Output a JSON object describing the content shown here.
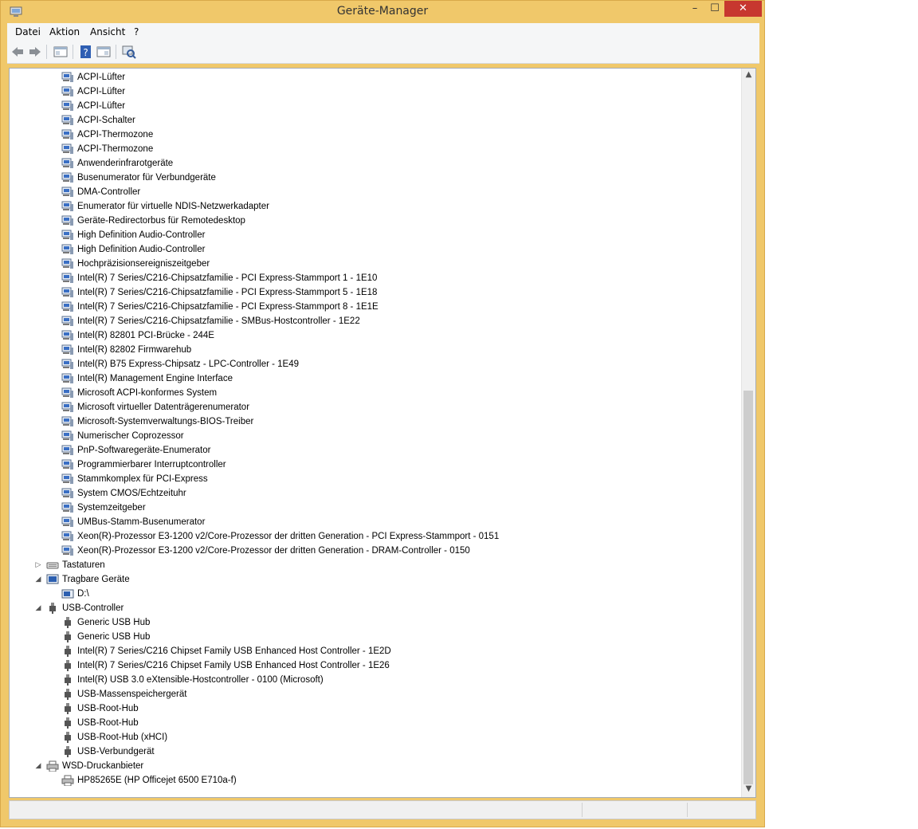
{
  "window": {
    "title": "Geräte-Manager",
    "close_label": "✕",
    "min_label": "–",
    "max_label": "☐"
  },
  "menu": {
    "items": [
      "Datei",
      "Aktion",
      "Ansicht",
      "?"
    ]
  },
  "colors": {
    "title_bg": "#f0c86a",
    "close_bg": "#c7372f"
  },
  "tree": {
    "system_devices": [
      "ACPI-Lüfter",
      "ACPI-Lüfter",
      "ACPI-Lüfter",
      "ACPI-Schalter",
      "ACPI-Thermozone",
      "ACPI-Thermozone",
      "Anwenderinfrarotgeräte",
      "Busenumerator für Verbundgeräte",
      "DMA-Controller",
      "Enumerator für virtuelle NDIS-Netzwerkadapter",
      "Geräte-Redirectorbus für Remotedesktop",
      "High Definition Audio-Controller",
      "High Definition Audio-Controller",
      "Hochpräzisionsereigniszeitgeber",
      "Intel(R) 7 Series/C216-Chipsatzfamilie - PCI Express-Stammport 1 - 1E10",
      "Intel(R) 7 Series/C216-Chipsatzfamilie - PCI Express-Stammport 5 - 1E18",
      "Intel(R) 7 Series/C216-Chipsatzfamilie - PCI Express-Stammport 8 - 1E1E",
      "Intel(R) 7 Series/C216-Chipsatzfamilie - SMBus-Hostcontroller - 1E22",
      "Intel(R) 82801 PCI-Brücke - 244E",
      "Intel(R) 82802 Firmwarehub",
      "Intel(R) B75 Express-Chipsatz - LPC-Controller - 1E49",
      "Intel(R) Management Engine Interface",
      "Microsoft ACPI-konformes System",
      "Microsoft virtueller Datenträgerenumerator",
      "Microsoft-Systemverwaltungs-BIOS-Treiber",
      "Numerischer Coprozessor",
      "PnP-Softwaregeräte-Enumerator",
      "Programmierbarer Interruptcontroller",
      "Stammkomplex für PCI-Express",
      "System CMOS/Echtzeituhr",
      "Systemzeitgeber",
      "UMBus-Stamm-Busenumerator",
      "Xeon(R)-Prozessor E3-1200 v2/Core-Prozessor der dritten Generation - PCI Express-Stammport - 0151",
      "Xeon(R)-Prozessor E3-1200 v2/Core-Prozessor der dritten Generation - DRAM-Controller - 0150"
    ],
    "keyboards": {
      "label": "Tastaturen",
      "expander": "▷"
    },
    "portable": {
      "label": "Tragbare Geräte",
      "expander": "◢",
      "children": [
        "D:\\"
      ]
    },
    "usb": {
      "label": "USB-Controller",
      "expander": "◢",
      "children": [
        "Generic USB Hub",
        "Generic USB Hub",
        "Intel(R) 7 Series/C216 Chipset Family USB Enhanced Host Controller - 1E2D",
        "Intel(R) 7 Series/C216 Chipset Family USB Enhanced Host Controller - 1E26",
        "Intel(R) USB 3.0 eXtensible-Hostcontroller - 0100 (Microsoft)",
        "USB-Massenspeichergerät",
        "USB-Root-Hub",
        "USB-Root-Hub",
        "USB-Root-Hub (xHCI)",
        "USB-Verbundgerät"
      ]
    },
    "wsd": {
      "label": "WSD-Druckanbieter",
      "expander": "◢",
      "children": [
        "HP85265E (HP Officejet 6500 E710a-f)"
      ]
    }
  },
  "scrollbar": {
    "up": "▲",
    "down": "▼"
  }
}
